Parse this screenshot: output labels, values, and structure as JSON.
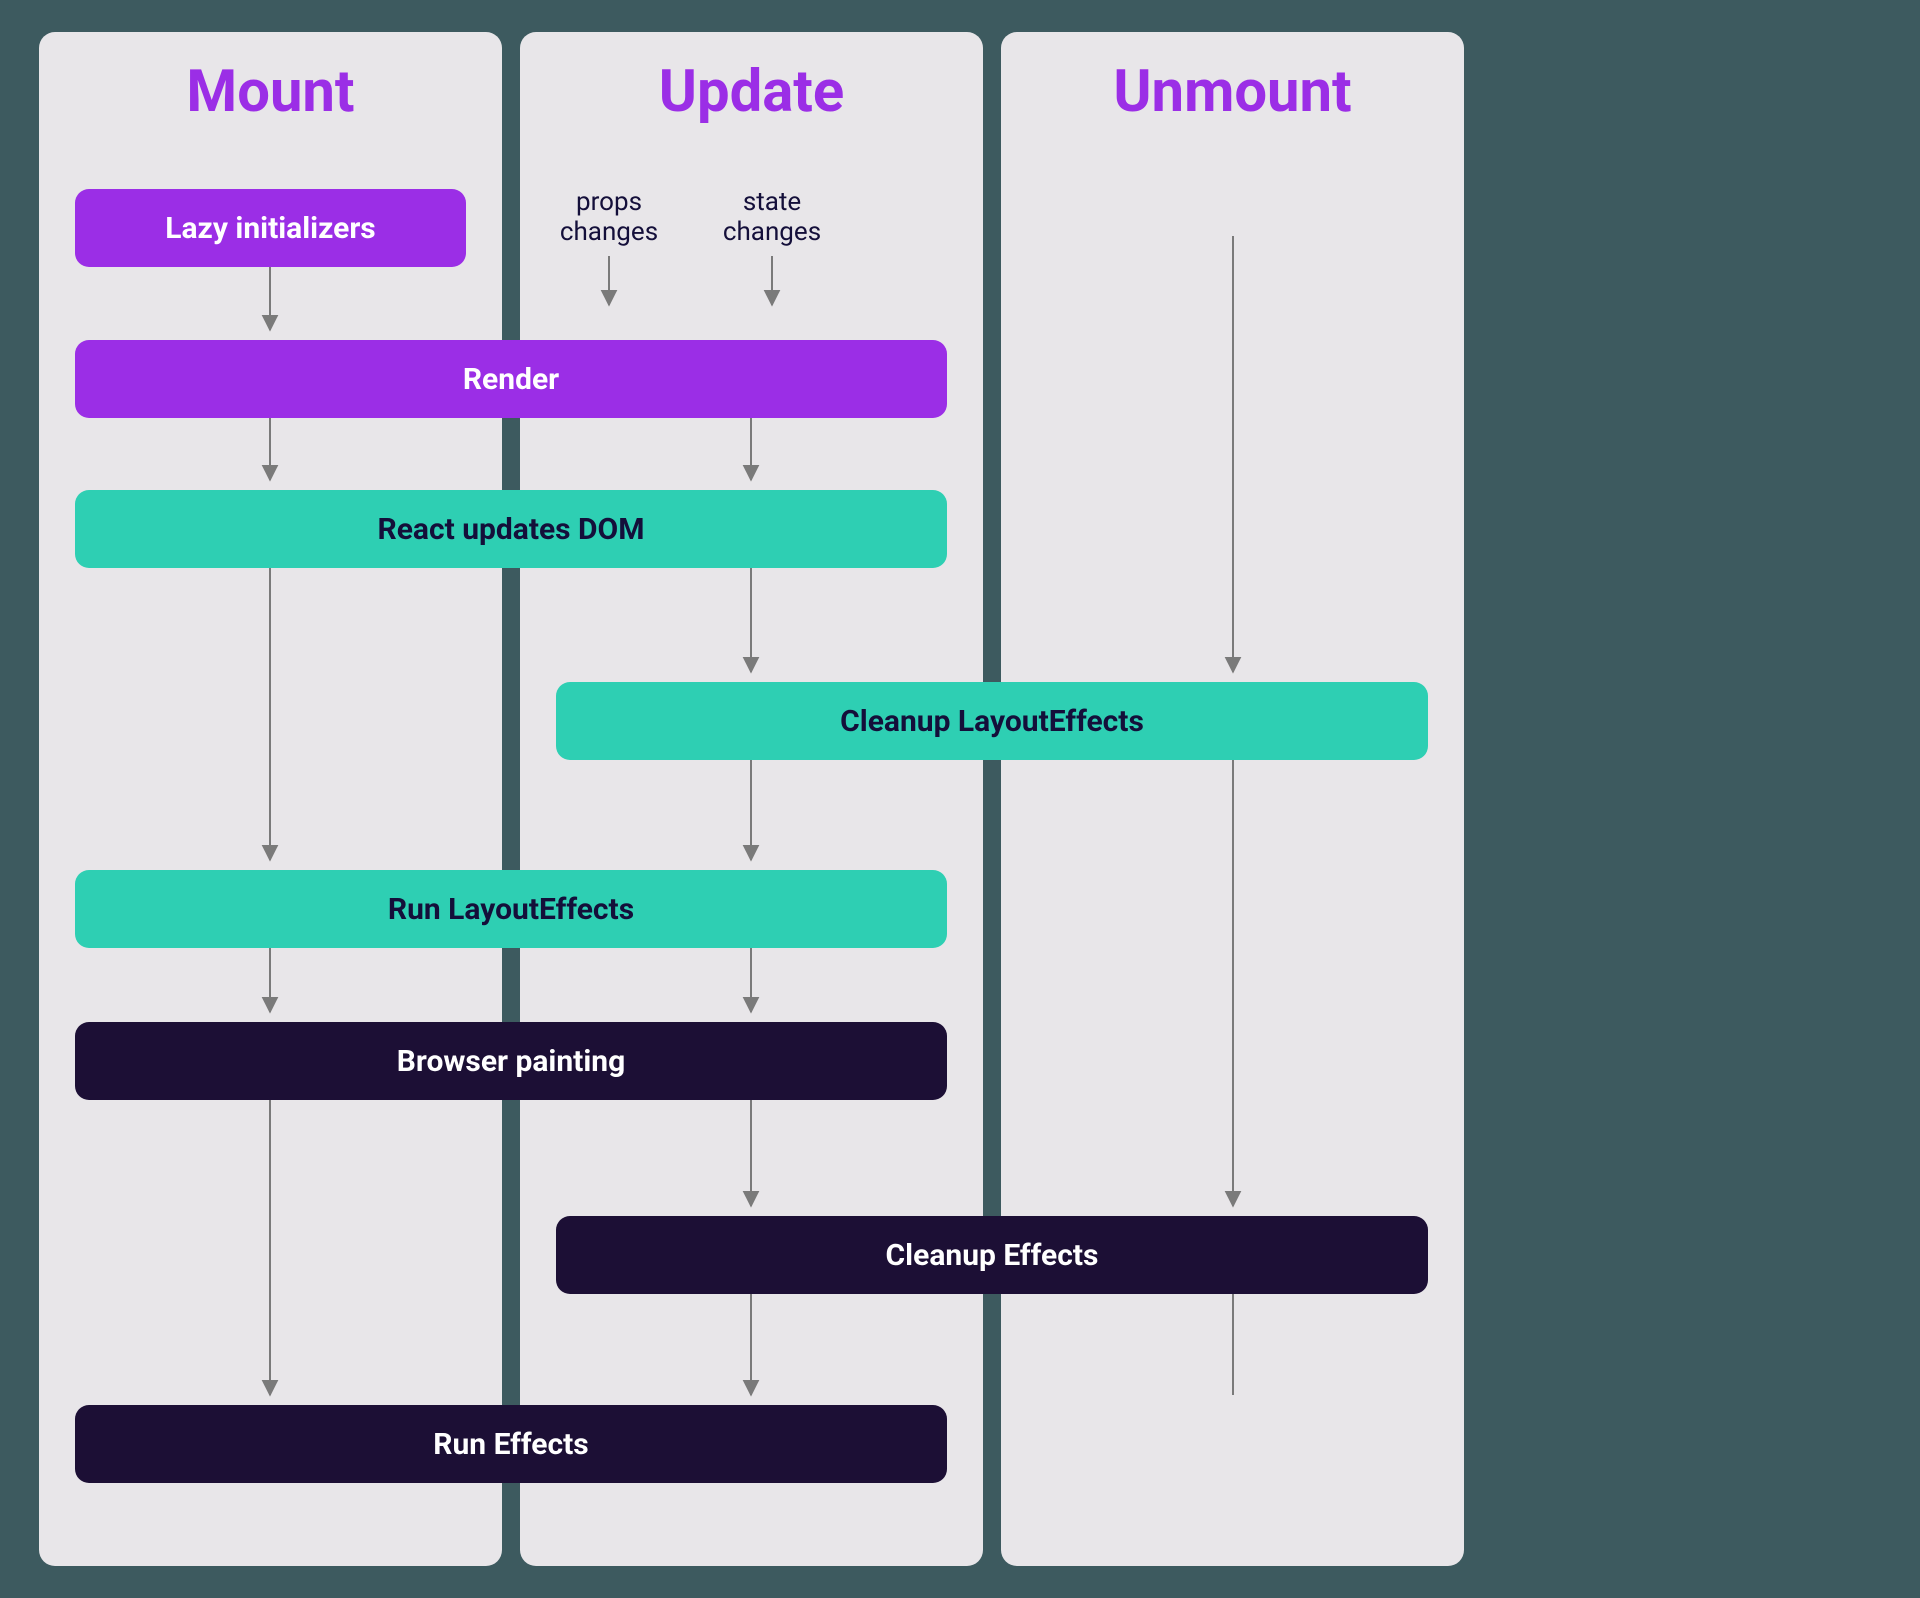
{
  "columns": {
    "mount": {
      "title": "Mount"
    },
    "update": {
      "title": "Update"
    },
    "unmount": {
      "title": "Unmount"
    }
  },
  "labels": {
    "props_changes": "props changes",
    "state_changes": "state changes"
  },
  "boxes": {
    "lazy_initializers": "Lazy initializers",
    "render": "Render",
    "react_updates_dom": "React updates DOM",
    "cleanup_layouteffects": "Cleanup LayoutEffects",
    "run_layouteffects": "Run LayoutEffects",
    "browser_painting": "Browser painting",
    "cleanup_effects": "Cleanup Effects",
    "run_effects": "Run Effects"
  },
  "colors": {
    "background": "#3d5a5f",
    "panel": "#e8e6e9",
    "title": "#9b2ee6",
    "purple": "#9b2ee6",
    "teal": "#2ecfb3",
    "dark": "#1c0f35",
    "arrow": "#7a7a7a"
  }
}
